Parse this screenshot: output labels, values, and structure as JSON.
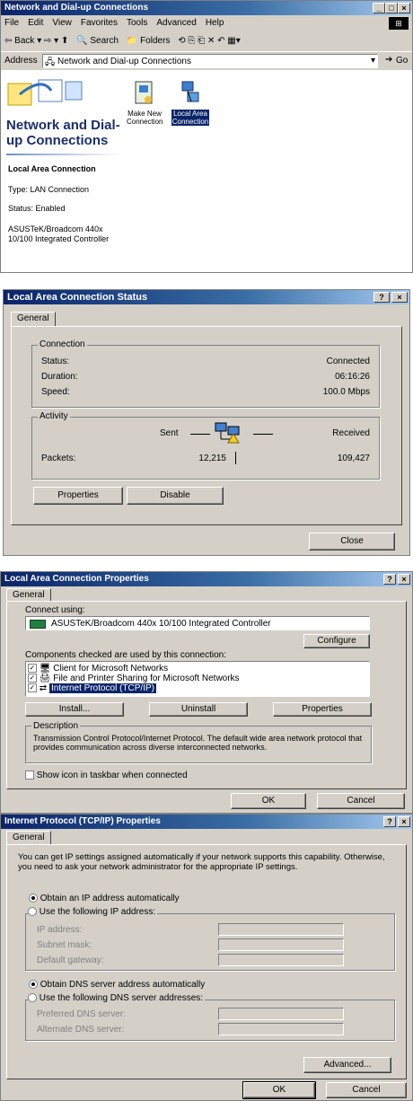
{
  "explorer": {
    "title": "Network and Dial-up Connections",
    "menu": [
      "File",
      "Edit",
      "View",
      "Favorites",
      "Tools",
      "Advanced",
      "Help"
    ],
    "toolbar": {
      "back": "Back",
      "search": "Search",
      "folders": "Folders"
    },
    "address_label": "Address",
    "address_value": "Network and Dial-up Connections",
    "go_label": "Go",
    "heading": "Network and Dial-up Connections",
    "icons": {
      "make_new": "Make New Connection",
      "local_area": "Local Area Connection"
    },
    "details": {
      "name": "Local Area Connection",
      "type": "Type: LAN Connection",
      "status": "Status: Enabled",
      "device": "ASUSTeK/Broadcom 440x 10/100 Integrated Controller"
    }
  },
  "status_dialog": {
    "title": "Local Area Connection Status",
    "tab": "General",
    "connection_group": "Connection",
    "rows": [
      {
        "label": "Status:",
        "value": "Connected"
      },
      {
        "label": "Duration:",
        "value": "06:16:26"
      },
      {
        "label": "Speed:",
        "value": "100.0 Mbps"
      }
    ],
    "activity_group": "Activity",
    "sent_label": "Sent",
    "received_label": "Received",
    "packets_label": "Packets:",
    "packets_sent": "12,215",
    "packets_received": "109,427",
    "properties_btn": "Properties",
    "disable_btn": "Disable",
    "close_btn": "Close"
  },
  "props_dialog": {
    "title": "Local Area Connection Properties",
    "tab": "General",
    "connect_using": "Connect using:",
    "adapter": "ASUSTeK/Broadcom 440x 10/100 Integrated Controller",
    "configure_btn": "Configure",
    "components_label": "Components checked are used by this connection:",
    "components": [
      "Client for Microsoft Networks",
      "File and Printer Sharing for Microsoft Networks",
      "Internet Protocol (TCP/IP)"
    ],
    "install_btn": "Install...",
    "uninstall_btn": "Uninstall",
    "properties_btn": "Properties",
    "description_label": "Description",
    "description": "Transmission Control Protocol/Internet Protocol. The default wide area network protocol that provides communication across diverse interconnected networks.",
    "show_icon": "Show icon in taskbar when connected",
    "ok_btn": "OK",
    "cancel_btn": "Cancel"
  },
  "tcpip_dialog": {
    "title": "Internet Protocol (TCP/IP) Properties",
    "tab": "General",
    "intro": "You can get IP settings assigned automatically if your network supports this capability. Otherwise, you need to ask your network administrator for the appropriate IP settings.",
    "obtain_ip": "Obtain an IP address automatically",
    "use_ip": "Use the following IP address:",
    "ip_address": "IP address:",
    "subnet_mask": "Subnet mask:",
    "default_gateway": "Default gateway:",
    "obtain_dns": "Obtain DNS server address automatically",
    "use_dns": "Use the following DNS server addresses:",
    "preferred_dns": "Preferred DNS server:",
    "alternate_dns": "Alternate DNS server:",
    "advanced_btn": "Advanced...",
    "ok_btn": "OK",
    "cancel_btn": "Cancel"
  }
}
